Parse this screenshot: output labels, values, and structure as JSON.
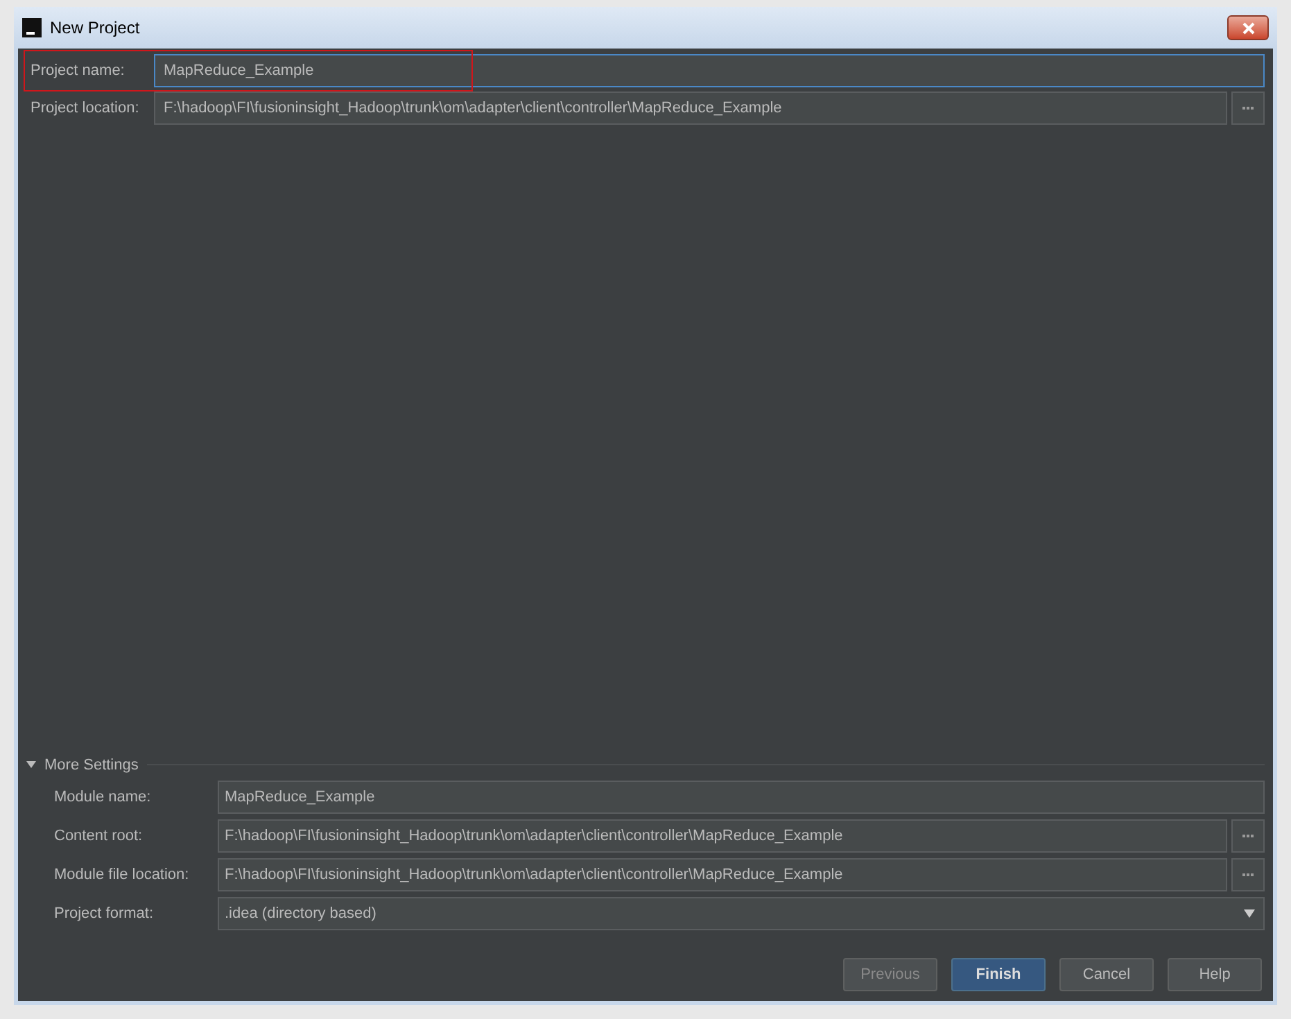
{
  "window": {
    "title": "New Project"
  },
  "fields": [
    {
      "label": "Project name:",
      "value": "MapReduce_Example",
      "focused": true,
      "browse": false,
      "highlighted": true
    },
    {
      "label": "Project location:",
      "value": "F:\\hadoop\\FI\\fusioninsight_Hadoop\\trunk\\om\\adapter\\client\\controller\\MapReduce_Example",
      "focused": false,
      "browse": true,
      "highlighted": false
    }
  ],
  "more_settings": {
    "title": "More Settings",
    "expanded": true,
    "fields": [
      {
        "kind": "text",
        "label": "Module name:",
        "value": "MapReduce_Example",
        "browse": false
      },
      {
        "kind": "text",
        "label": "Content root:",
        "value": "F:\\hadoop\\FI\\fusioninsight_Hadoop\\trunk\\om\\adapter\\client\\controller\\MapReduce_Example",
        "browse": true
      },
      {
        "kind": "text",
        "label": "Module file location:",
        "value": "F:\\hadoop\\FI\\fusioninsight_Hadoop\\trunk\\om\\adapter\\client\\controller\\MapReduce_Example",
        "browse": true
      },
      {
        "kind": "select",
        "label": "Project format:",
        "value": ".idea (directory based)",
        "browse": false
      }
    ]
  },
  "buttons": [
    {
      "label": "Previous",
      "disabled": true,
      "default": false
    },
    {
      "label": "Finish",
      "disabled": false,
      "default": true
    },
    {
      "label": "Cancel",
      "disabled": false,
      "default": false
    },
    {
      "label": "Help",
      "disabled": false,
      "default": false
    }
  ]
}
